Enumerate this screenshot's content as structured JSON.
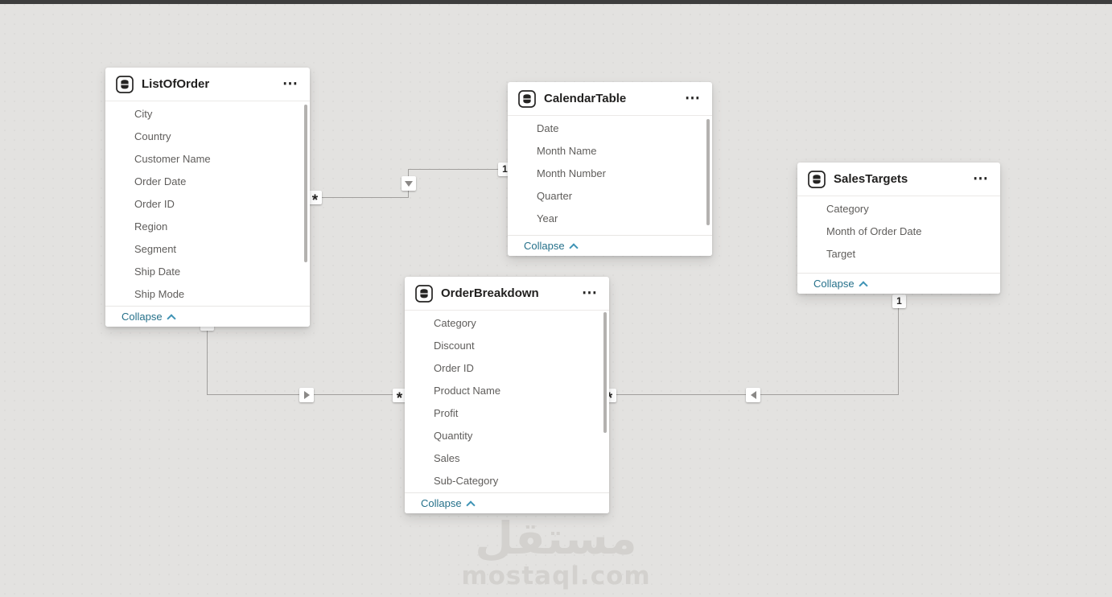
{
  "icons": {
    "table": "database-table-icon",
    "more": "⋯",
    "collapse_chevron": "chevron-up"
  },
  "colors": {
    "canvas": "#e3e2e0",
    "card": "#ffffff",
    "line": "#a19f9d",
    "collapse_link": "#25708a",
    "header_text": "#201f1e",
    "field_text": "#5f5d5b"
  },
  "tables": [
    {
      "title": "ListOfOrder",
      "fields": [
        "City",
        "Country",
        "Customer Name",
        "Order Date",
        "Order ID",
        "Region",
        "Segment",
        "Ship Date",
        "Ship Mode"
      ],
      "collapse_label": "Collapse"
    },
    {
      "title": "CalendarTable",
      "fields": [
        "Date",
        "Month Name",
        "Month Number",
        "Quarter",
        "Year"
      ],
      "collapse_label": "Collapse"
    },
    {
      "title": "SalesTargets",
      "fields": [
        "Category",
        "Month of Order Date",
        "Target"
      ],
      "collapse_label": "Collapse"
    },
    {
      "title": "OrderBreakdown",
      "fields": [
        "Category",
        "Discount",
        "Order ID",
        "Product Name",
        "Profit",
        "Quantity",
        "Sales",
        "Sub-Category"
      ],
      "collapse_label": "Collapse"
    }
  ],
  "relationships": [
    {
      "from": "ListOfOrder",
      "to": "CalendarTable",
      "many_label": "*",
      "one_label": "1",
      "filter_arrow": "down"
    },
    {
      "from": "ListOfOrder",
      "to": "OrderBreakdown",
      "many_label": "*",
      "one_label": "1",
      "filter_arrow": "right"
    },
    {
      "from": "SalesTargets",
      "to": "OrderBreakdown",
      "many_label": "*",
      "one_label": "1",
      "filter_arrow": "left"
    }
  ],
  "watermark": {
    "logo": "مستقل",
    "site": "mostaql.com"
  }
}
